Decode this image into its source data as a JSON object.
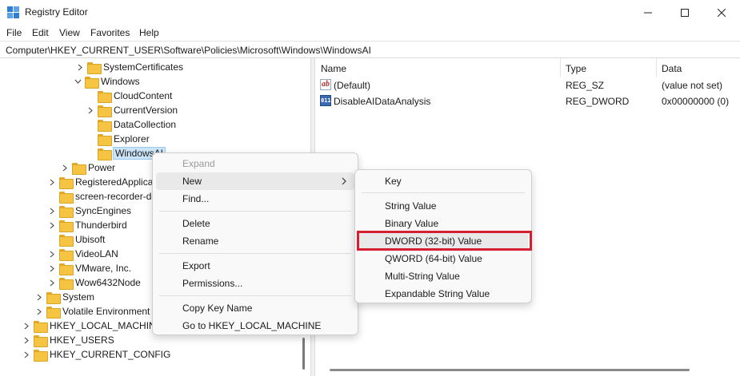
{
  "window": {
    "title": "Registry Editor"
  },
  "menu": [
    "File",
    "Edit",
    "View",
    "Favorites",
    "Help"
  ],
  "address": "Computer\\HKEY_CURRENT_USER\\Software\\Policies\\Microsoft\\Windows\\WindowsAI",
  "tree": [
    {
      "label": "SystemCertificates",
      "expander": "collapsed"
    },
    {
      "label": "Windows",
      "expander": "expanded"
    },
    {
      "label": "CloudContent",
      "expander": "none"
    },
    {
      "label": "CurrentVersion",
      "expander": "collapsed"
    },
    {
      "label": "DataCollection",
      "expander": "none"
    },
    {
      "label": "Explorer",
      "expander": "none"
    },
    {
      "label": "WindowsAI",
      "expander": "none",
      "selected": true
    },
    {
      "label": "Power",
      "expander": "collapsed"
    },
    {
      "label": "RegisteredApplications",
      "expander": "collapsed"
    },
    {
      "label": "screen-recorder-desktop",
      "expander": "none"
    },
    {
      "label": "SyncEngines",
      "expander": "collapsed"
    },
    {
      "label": "Thunderbird",
      "expander": "collapsed"
    },
    {
      "label": "Ubisoft",
      "expander": "none"
    },
    {
      "label": "VideoLAN",
      "expander": "collapsed"
    },
    {
      "label": "VMware, Inc.",
      "expander": "collapsed"
    },
    {
      "label": "Wow6432Node",
      "expander": "collapsed"
    },
    {
      "label": "System",
      "expander": "collapsed"
    },
    {
      "label": "Volatile Environment",
      "expander": "collapsed"
    },
    {
      "label": "HKEY_LOCAL_MACHINE",
      "expander": "collapsed"
    },
    {
      "label": "HKEY_USERS",
      "expander": "collapsed"
    },
    {
      "label": "HKEY_CURRENT_CONFIG",
      "expander": "collapsed"
    }
  ],
  "list": {
    "columns": [
      "Name",
      "Type",
      "Data"
    ],
    "rows": [
      {
        "icon": "string-value-icon",
        "name": "(Default)",
        "type": "REG_SZ",
        "data": "(value not set)"
      },
      {
        "icon": "dword-value-icon",
        "name": "DisableAIDataAnalysis",
        "type": "REG_DWORD",
        "data": "0x00000000 (0)"
      }
    ]
  },
  "context_menu": {
    "expand": "Expand",
    "new": "New",
    "find": "Find...",
    "delete": "Delete",
    "rename": "Rename",
    "export": "Export",
    "permissions": "Permissions...",
    "copy_key_name": "Copy Key Name",
    "goto": "Go to HKEY_LOCAL_MACHINE"
  },
  "submenu": {
    "key": "Key",
    "string": "String Value",
    "binary": "Binary Value",
    "dword": "DWORD (32-bit) Value",
    "qword": "QWORD (64-bit) Value",
    "multi": "Multi-String Value",
    "expandable": "Expandable String Value"
  },
  "colors": {
    "highlight": "#d42030",
    "selection": "#cce4f7",
    "folder": "#f6c443"
  }
}
